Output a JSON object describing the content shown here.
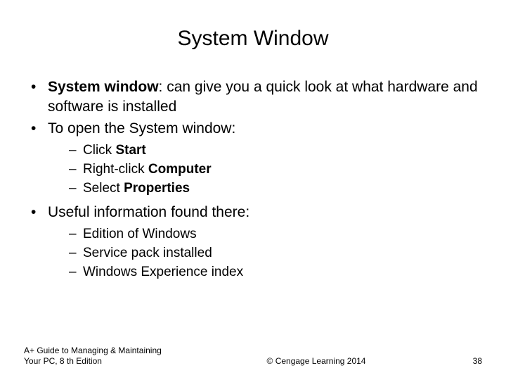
{
  "title": "System Window",
  "bullets": {
    "b1_bold": "System window",
    "b1_rest": ": can give you a quick look at what hardware and software is installed",
    "b2": "To open the System window:",
    "b2_sub": {
      "s1_pre": "Click ",
      "s1_bold": "Start",
      "s2_pre": "Right-click ",
      "s2_bold": "Computer",
      "s3_pre": "Select ",
      "s3_bold": "Properties"
    },
    "b3": "Useful information found there:",
    "b3_sub": {
      "s1": "Edition of Windows",
      "s2": "Service pack installed",
      "s3": "Windows Experience index"
    }
  },
  "footer": {
    "left": "A+ Guide to Managing & Maintaining Your PC, 8 th Edition",
    "center": "© Cengage Learning  2014",
    "page": "38"
  }
}
